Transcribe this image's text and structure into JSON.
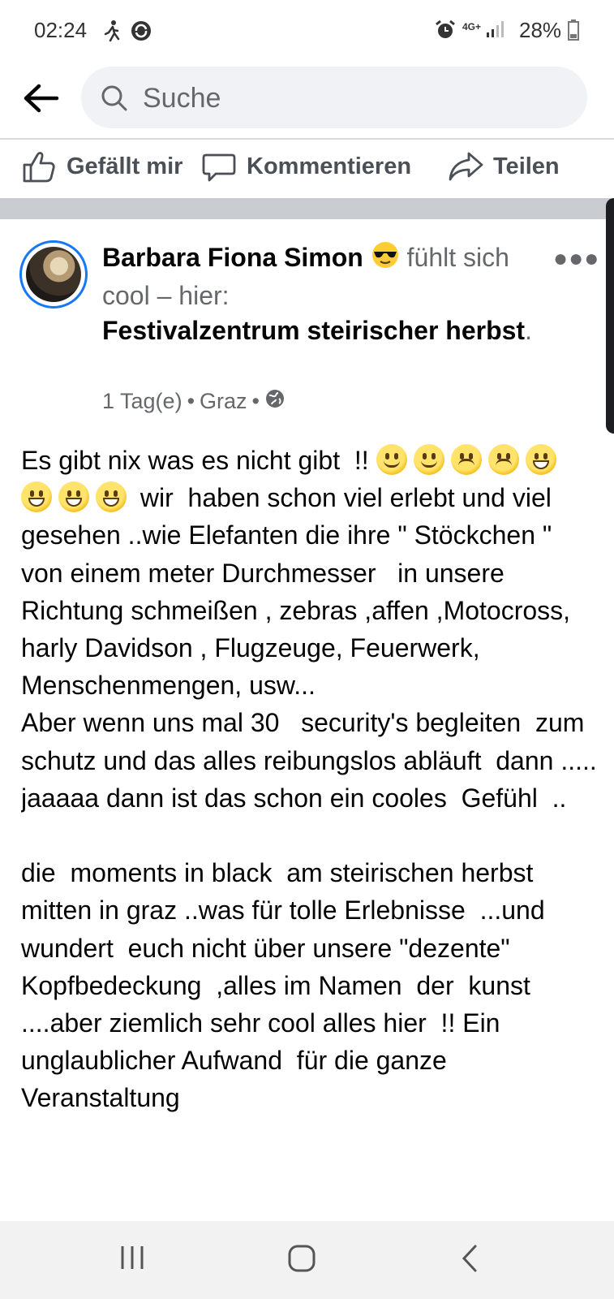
{
  "status_bar": {
    "time": "02:24",
    "network": "4G+",
    "battery": "28%"
  },
  "search": {
    "placeholder": "Suche"
  },
  "actions": {
    "like": "Gefällt mir",
    "comment": "Kommentieren",
    "share": "Teilen"
  },
  "post": {
    "author": "Barbara Fiona Simon",
    "feeling": "fühlt sich cool – hier:",
    "location": "Festivalzentrum steirischer herbst",
    "location_suffix": ".",
    "time": "1 Tag(e)",
    "place": "Graz",
    "separator": "•",
    "privacy_icon": "globe-icon",
    "line1": "Es gibt nix was es nicht gibt  !! ",
    "line2": " wir  haben schon viel erlebt und viel gesehen ..wie Elefanten die ihre \" Stöckchen \" von einem meter Durchmesser   in unsere Richtung schmeißen , zebras ,affen ,Motocross, harly Davidson , Flugzeuge, Feuerwerk, Menschenmengen, usw...\nAber wenn uns mal 30   security's begleiten  zum schutz und das alles reibungslos abläuft  dann ..... jaaaaa dann ist das schon ein cooles  Gefühl  ..\n\ndie  moments in black  am steirischen herbst  mitten in graz ..was für tolle Erlebnisse  ...und wundert  euch nicht über unsere \"dezente\"   Kopfbedeckung  ,alles im Namen  der  kunst  ....aber ziemlich sehr cool alles hier  !! Ein unglaublicher Aufwand  für die ganze  Veranstaltung"
  },
  "colors": {
    "accent": "#1877f2",
    "divider": "#c9ccd1",
    "text_secondary": "#65676b"
  }
}
